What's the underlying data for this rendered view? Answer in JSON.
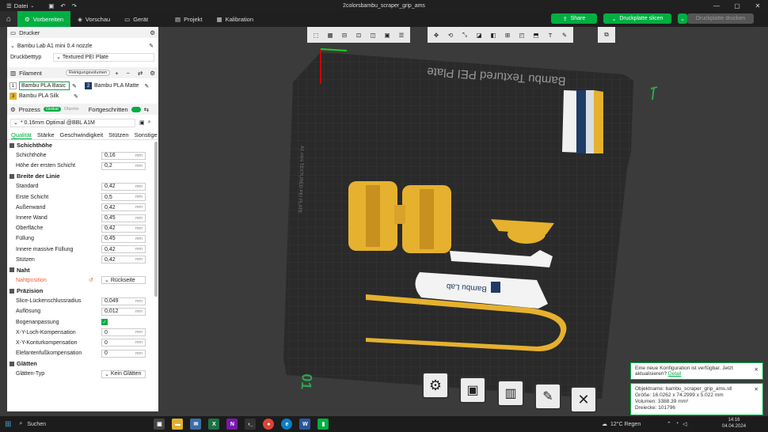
{
  "window": {
    "title": "2colorsbambu_scraper_grip_ams",
    "menu_label": "Datei"
  },
  "toolbar": {
    "tabs": [
      {
        "label": "Vorbereiten",
        "active": true
      },
      {
        "label": "Vorschau",
        "active": false
      },
      {
        "label": "Gerät",
        "active": false
      },
      {
        "label": "Projekt",
        "active": false
      },
      {
        "label": "Kalibration",
        "active": false
      }
    ],
    "share_label": "Share",
    "slice_label": "Druckplatte slicen",
    "print_label": "Druckplatte drucken"
  },
  "printer": {
    "section_label": "Drucker",
    "printer_name": "Bambu Lab A1 mini 0.4 nozzle",
    "bed_type_label": "Druckbetttyp",
    "bed_type_value": "Textured PEI Plate"
  },
  "filament": {
    "section_label": "Filament",
    "clean_button": "Reinigungsvolumen",
    "items": [
      {
        "num": "1",
        "name": "Bambu PLA Basic",
        "color": "#ffffff"
      },
      {
        "num": "2",
        "name": "Bambu PLA Matte",
        "color": "#1f3b66"
      },
      {
        "num": "3",
        "name": "Bambu PLA Silk",
        "color": "#e6b12e"
      }
    ]
  },
  "process": {
    "section_label": "Prozess",
    "toggle_global": "Global",
    "toggle_objects": "Objekte",
    "advanced_label": "Fortgeschritten",
    "profile": "* 0.16mm Optimal @BBL A1M",
    "tabs": [
      "Qualität",
      "Stärke",
      "Geschwindigkeit",
      "Stützen",
      "Sonstige"
    ]
  },
  "groups": {
    "layer_height": {
      "title": "Schichthöhe",
      "params": [
        {
          "label": "Schichthöhe",
          "value": "0,16",
          "unit": "mm"
        },
        {
          "label": "Höhe der ersten Schicht",
          "value": "0,2",
          "unit": "mm"
        }
      ]
    },
    "line_width": {
      "title": "Breite der Linie",
      "params": [
        {
          "label": "Standard",
          "value": "0,42",
          "unit": "mm"
        },
        {
          "label": "Erste Schicht",
          "value": "0,5",
          "unit": "mm"
        },
        {
          "label": "Außenwand",
          "value": "0,42",
          "unit": "mm"
        },
        {
          "label": "Innere Wand",
          "value": "0,45",
          "unit": "mm"
        },
        {
          "label": "Oberfläche",
          "value": "0,42",
          "unit": "mm"
        },
        {
          "label": "Füllung",
          "value": "0,45",
          "unit": "mm"
        },
        {
          "label": "Innere massive Füllung",
          "value": "0,42",
          "unit": "mm"
        },
        {
          "label": "Stützen",
          "value": "0,42",
          "unit": "mm"
        }
      ]
    },
    "seam": {
      "title": "Naht",
      "param_label": "Nahtposition",
      "param_value": "Rückseite"
    },
    "precision": {
      "title": "Präzision",
      "params": [
        {
          "label": "Slice-Lückenschlussradius",
          "value": "0,049",
          "unit": "mm"
        },
        {
          "label": "Auflösung",
          "value": "0,012",
          "unit": "mm"
        },
        {
          "label": "Bogenanpassung",
          "value": "",
          "unit": ""
        },
        {
          "label": "X-Y-Loch-Kompensation",
          "value": "0",
          "unit": "mm"
        },
        {
          "label": "X-Y-Konturkompensation",
          "value": "0",
          "unit": "mm"
        },
        {
          "label": "Elefantenfußkompensation",
          "value": "0",
          "unit": "mm"
        }
      ]
    },
    "smoothing": {
      "title": "Glätten",
      "param_label": "Glätten-Typ",
      "param_value": "Kein Glätten"
    }
  },
  "plate": {
    "label": "Bambu Textured PEI Plate",
    "number": "01",
    "side_text": "A1 mini TEXTURED PEI PLATE"
  },
  "object_info": {
    "line1": "Objektname: bambu_scraper_grip_ams.stl",
    "line2": "Größe: 16.0262 x 74.2999 x 5.022 mm",
    "line3": "Volumen: 3388.39 mm³",
    "line4": "Dreiecke: 101796"
  },
  "notification": {
    "text": "Eine neue Konfiguration ist verfügbar. Jetzt aktualisieren?",
    "link": "Detail"
  },
  "model_text": "Bambu Lab",
  "taskbar": {
    "search": "Suchen",
    "weather": "12°C  Regen",
    "time": "14:16",
    "date": "04.04.2024"
  },
  "colors": {
    "accent": "#00ae42",
    "plate": "#2c2c2c",
    "yellow": "#e6b12e",
    "navy": "#1f3b66"
  }
}
